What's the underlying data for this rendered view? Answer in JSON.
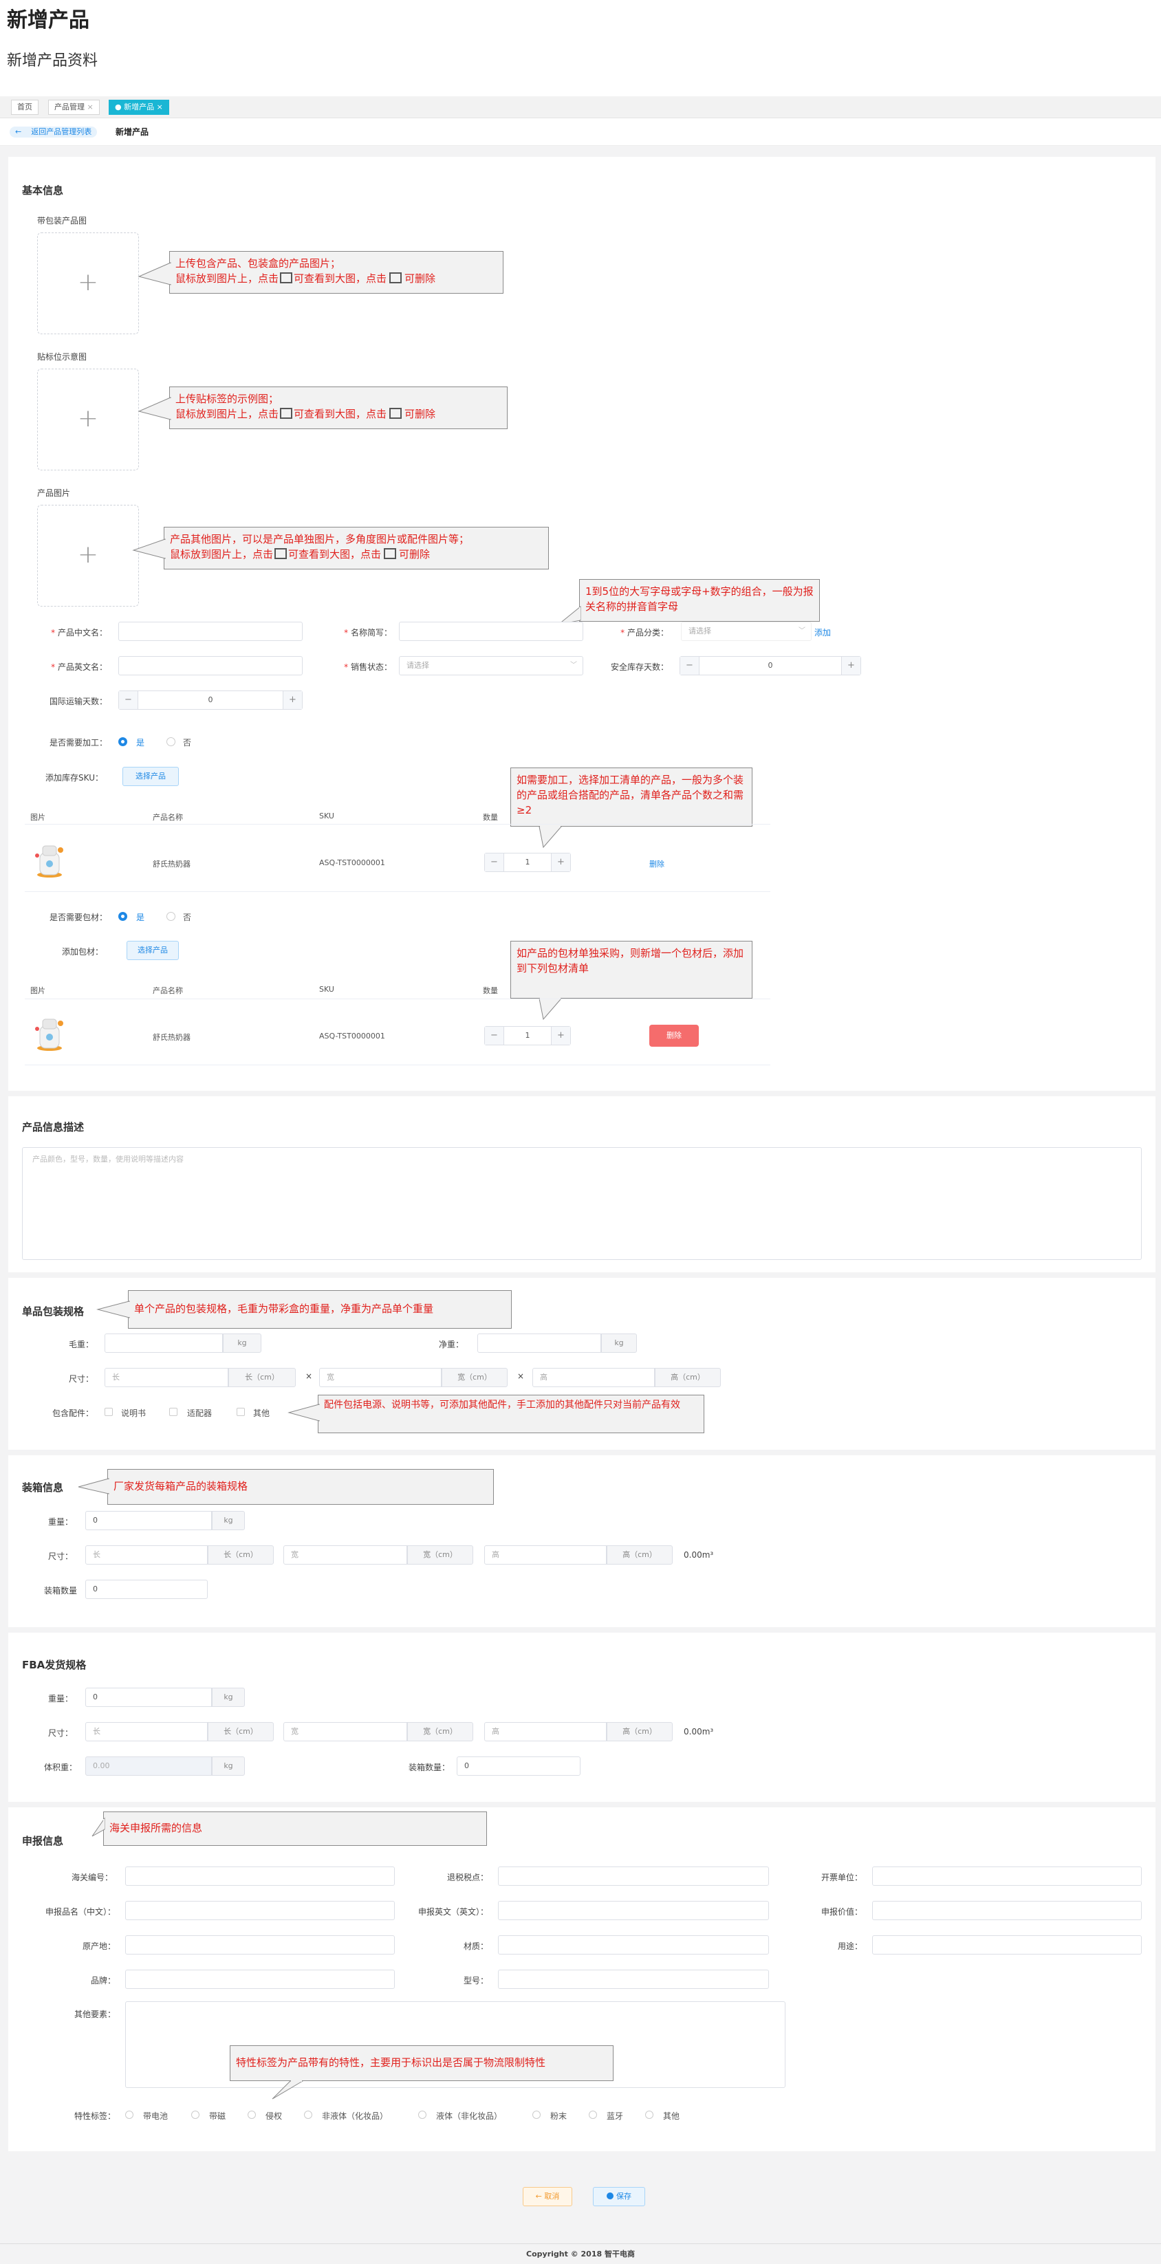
{
  "header": {
    "title": "新增产品",
    "subtitle": "新增产品资料"
  },
  "tabs": [
    {
      "label": "首页"
    },
    {
      "label": "产品管理",
      "close": "×"
    },
    {
      "label": "● 新增产品",
      "close": "×"
    }
  ],
  "breadcrumb": {
    "back_icon": "←",
    "back": "返回产品管理列表",
    "current": "新增产品"
  },
  "basic": {
    "title": "基本信息",
    "pkg_img_label": "带包装产品图",
    "label_img_label": "贴标位示意图",
    "prod_img_label": "产品图片",
    "upload_plus": "+",
    "cn_name_label": "产品中文名：",
    "short_name_label": "名称简写：",
    "category_label": "产品分类：",
    "category_placeholder": "请选择",
    "category_add": "添加",
    "en_name_label": "产品英文名：",
    "sale_status_label": "销售状态：",
    "sale_status_placeholder": "请选择",
    "safety_days_label": "安全库存天数：",
    "safety_days_value": "0",
    "intl_days_label": "国际运输天数：",
    "intl_days_value": "0",
    "need_process_label": "是否需要加工：",
    "yes": "是",
    "no": "否",
    "add_sku_label": "添加库存SKU：",
    "select_product_btn": "选择产品",
    "table_headers": [
      "图片",
      "产品名称",
      "SKU",
      "数量"
    ],
    "sku_row": {
      "name": "舒氏热奶器",
      "sku": "ASQ-TST0000001",
      "qty": "1",
      "delete": "删除"
    },
    "need_packaging_label": "是否需要包材：",
    "add_packaging_label": "添加包材：",
    "pack_row": {
      "name": "舒氏热奶器",
      "sku": "ASQ-TST0000001",
      "qty": "1",
      "delete": "删除"
    }
  },
  "callouts": {
    "c1": [
      "上传包含产品、包装盒的产品图片；",
      "鼠标放到图片上，点击",
      "可查看到大图，点击",
      "可删除"
    ],
    "c2": [
      "上传贴标签的示例图；",
      "鼠标放到图片上，点击",
      "可查看到大图，点击",
      "可删除"
    ],
    "c3": [
      "产品其他图片，可以是产品单独图片，多角度图片或配件图片等；",
      "鼠标放到图片上，点击",
      "可查看到大图，点击",
      "可删除"
    ],
    "c4": "1到5位的大写字母或字母+数字的组合，一般为报关名称的拼音首字母",
    "c5": "如需要加工，选择加工清单的产品，一般为多个装的产品或组合搭配的产品，清单各产品个数之和需≥2",
    "c6": "如产品的包材单独采购，则新增一个包材后，添加到下列包材清单",
    "c7": "单个产品的包装规格，毛重为带彩盒的重量，净重为产品单个重量",
    "c8": "配件包括电源、说明书等，可添加其他配件，手工添加的其他配件只对当前产品有效",
    "c9": "厂家发货每箱产品的装箱规格",
    "c10": "海关申报所需的信息",
    "c11": "特性标签为产品带有的特性，主要用于标识出是否属于物流限制特性"
  },
  "desc": {
    "title": "产品信息描述",
    "placeholder": "产品颜色，型号，数量，使用说明等描述内容"
  },
  "single_pkg": {
    "title": "单品包装规格",
    "gross_label": "毛重：",
    "net_label": "净重：",
    "kg": "kg",
    "size_label": "尺寸：",
    "l_ph": "长",
    "w_ph": "宽",
    "h_ph": "高",
    "l_unit": "长（cm）",
    "w_unit": "宽（cm）",
    "h_unit": "高（cm）",
    "times": "×",
    "acc_label": "包含配件：",
    "acc_items": [
      "说明书",
      "适配器",
      "其他"
    ]
  },
  "carton": {
    "title": "装箱信息",
    "weight_label": "重量：",
    "weight_value": "0",
    "kg": "kg",
    "size_label": "尺寸：",
    "l_ph": "长",
    "w_ph": "宽",
    "h_ph": "高",
    "l_unit": "长（cm）",
    "w_unit": "宽（cm）",
    "h_unit": "高（cm）",
    "volume": "0.00m³",
    "qty_label": "装箱数量",
    "qty_value": "0"
  },
  "fba": {
    "title": "FBA发货规格",
    "weight_label": "重量：",
    "weight_value": "0",
    "kg": "kg",
    "size_label": "尺寸：",
    "l_ph": "长",
    "w_ph": "宽",
    "h_ph": "高",
    "l_unit": "长（cm）",
    "w_unit": "宽（cm）",
    "h_unit": "高（cm）",
    "volume": "0.00m³",
    "volwt_label": "体积重：",
    "volwt_value": "0.00",
    "qty_label": "装箱数量：",
    "qty_value": "0"
  },
  "customs": {
    "title": "申报信息",
    "hs_label": "海关编号：",
    "rebate_label": "退税税点：",
    "invoice_unit_label": "开票单位：",
    "cn_name_label": "申报品名（中文）：",
    "en_name_label": "申报英文（英文）：",
    "value_label": "申报价值：",
    "origin_label": "原产地：",
    "material_label": "材质：",
    "usage_label": "用途：",
    "brand_label": "品牌：",
    "model_label": "型号：",
    "other_label": "其他要素：",
    "feature_label": "特性标签：",
    "features": [
      "带电池",
      "带磁",
      "侵权",
      "非液体（化妆品）",
      "液体（非化妆品）",
      "粉末",
      "蓝牙",
      "其他"
    ]
  },
  "footer": {
    "cancel": "← 取消",
    "save": "保存",
    "copyright": "Copyright © 2018 智干电商"
  },
  "colors": {
    "accent": "#1e88e5",
    "tab_active": "#1ab6d4",
    "danger": "#f56c6c",
    "callout_text": "#e0201c"
  }
}
